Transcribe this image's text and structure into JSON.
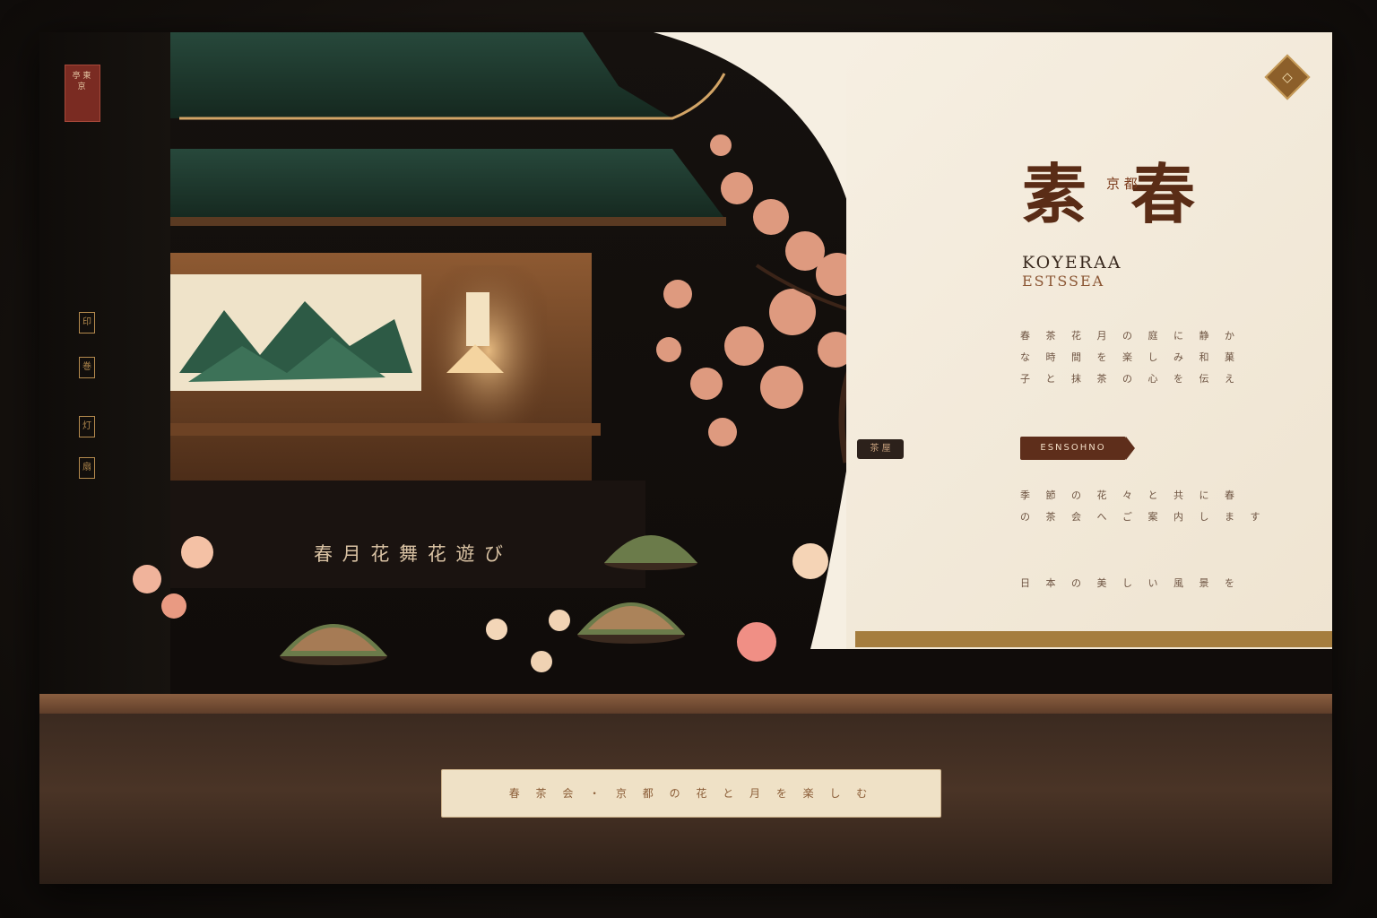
{
  "left_rail": {
    "seal_text": "亭 東 京",
    "icons": [
      "hanko-icon",
      "scroll-icon",
      "lantern-icon",
      "fan-icon"
    ]
  },
  "hero": {
    "script_text": "春 月 花 舞 花 遊 び",
    "tag_label": "茶 屋"
  },
  "brand": {
    "emblem": "◇",
    "title": "素 春",
    "title_mid": "京 都",
    "subtitle_1": "KOYERAA",
    "subtitle_2": "ESTSSEA",
    "paragraphs": [
      "春 茶 花 月 の 庭 に 静 か",
      "な 時 間 を 楽 し み 和 菓",
      "子 と 抹 茶 の 心 を 伝 え"
    ],
    "cta_label": "ESNSOHNO",
    "paragraphs_2": [
      "季 節 の 花 々 と 共 に 春",
      "の 茶 会 へ ご 案 内 し ま す",
      "日 本 の 美 し い 風 景 を"
    ]
  },
  "footer": {
    "bar_text": "春 茶 会 ・ 京 都 の 花 と 月 を 楽 し む"
  }
}
